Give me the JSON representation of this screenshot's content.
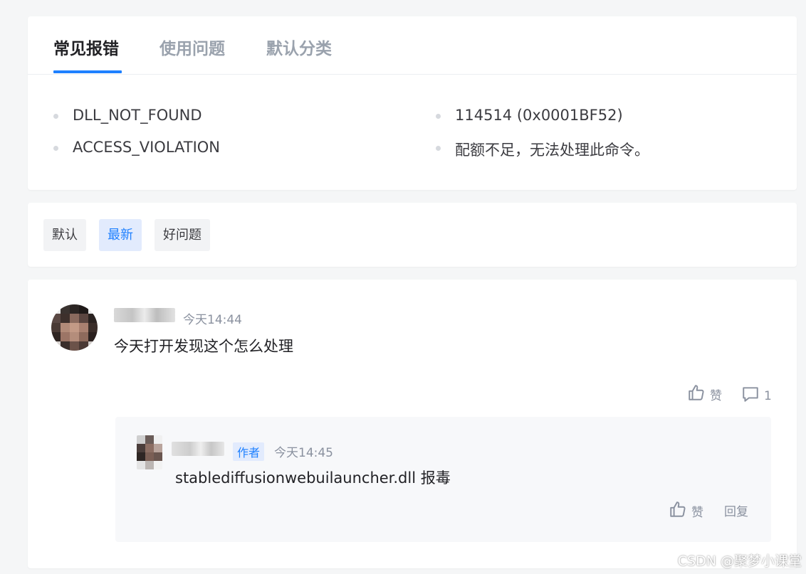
{
  "tabs": [
    {
      "label": "常见报错",
      "active": true
    },
    {
      "label": "使用问题",
      "active": false
    },
    {
      "label": "默认分类",
      "active": false
    }
  ],
  "errors": [
    "DLL_NOT_FOUND",
    "114514 (0x0001BF52)",
    "ACCESS_VIOLATION",
    "配额不足，无法处理此命令。"
  ],
  "sort": [
    {
      "label": "默认",
      "active": false
    },
    {
      "label": "最新",
      "active": true
    },
    {
      "label": "好问题",
      "active": false
    }
  ],
  "comment": {
    "time": "今天14:44",
    "content": "今天打开发现这个怎么处理",
    "like_label": "赞",
    "reply_count": "1"
  },
  "reply": {
    "author_badge": "作者",
    "time": "今天14:45",
    "content": "stablediffusionwebuilauncher.dll 报毒",
    "like_label": "赞",
    "reply_label": "回复"
  },
  "watermark": "CSDN @聚梦小课堂",
  "colors": {
    "accent": "#1e80ff",
    "muted": "#8a919f",
    "page_bg": "#f5f6f7"
  },
  "icons": [
    "thumbs-up-icon",
    "comment-bubble-icon"
  ]
}
